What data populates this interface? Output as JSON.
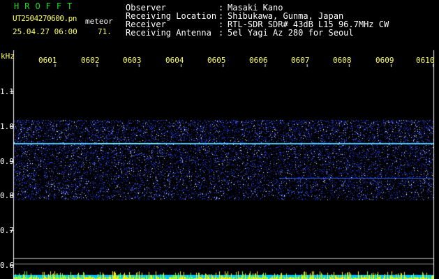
{
  "header": {
    "brand": "HROFFT",
    "filename": "UT2504270600.pn",
    "tag": "meteor",
    "date": "25.04.27 06:00",
    "count": "71."
  },
  "station": [
    {
      "label": "Observer",
      "value": "Masaki Kano"
    },
    {
      "label": "Receiving Location",
      "value": "Shibukawa, Gunma, Japan"
    },
    {
      "label": "Receiver",
      "value": "RTL-SDR SDR# 43dB L15 96.7MHz CW"
    },
    {
      "label": "Receiving Antenna",
      "value": "5el Yagi Az 280 for Seoul"
    }
  ],
  "axis": {
    "y_unit": "kHz",
    "y_ticks": [
      "1.1",
      "1.0",
      "0.9",
      "0.8",
      "0.7",
      "0.6"
    ],
    "x_ticks": [
      "0601",
      "0602",
      "0603",
      "0604",
      "0605",
      "0606",
      "0607",
      "0608",
      "0609",
      "0610"
    ]
  },
  "colors": {
    "noise": "#1f3cff",
    "carrier": "#55ccff",
    "time_label": "#ffff66",
    "brand": "#1fdc1f",
    "histogram": "#ffee00",
    "histogram_base": "#00c8ff"
  }
}
